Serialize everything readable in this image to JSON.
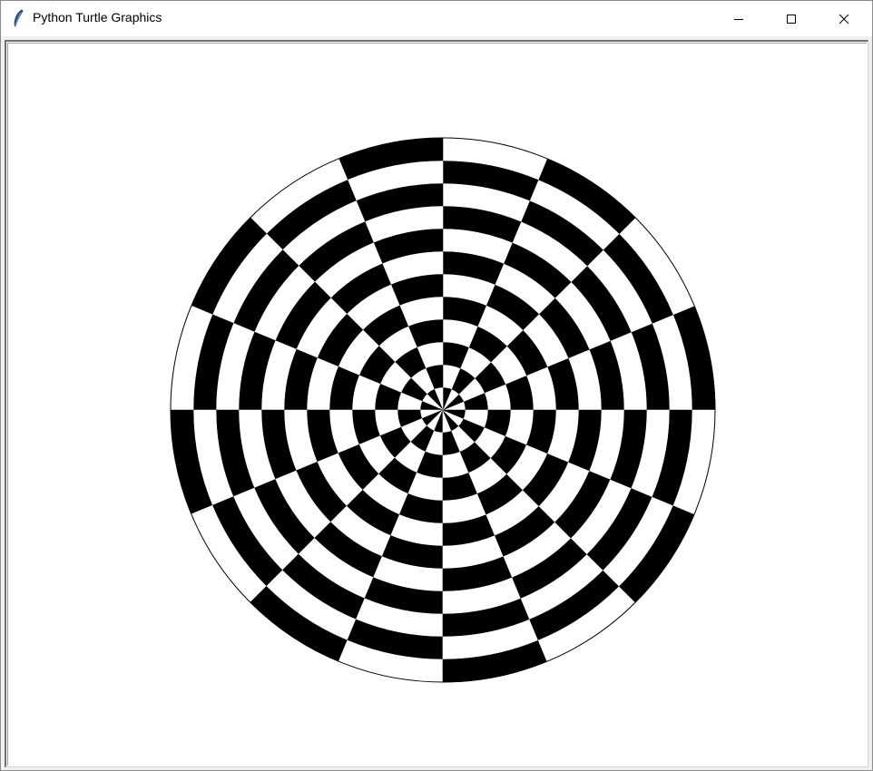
{
  "window": {
    "title": "Python Turtle Graphics",
    "icon": "feather-icon",
    "controls": [
      "minimize-icon",
      "maximize-icon",
      "close-icon"
    ]
  },
  "canvas": {
    "background": "#ffffff",
    "drawing": {
      "shape": "circular checkerboard",
      "rings": 12,
      "sectors": 16,
      "colors": [
        "#000000",
        "#ffffff"
      ],
      "outline_color": "#000000"
    }
  }
}
